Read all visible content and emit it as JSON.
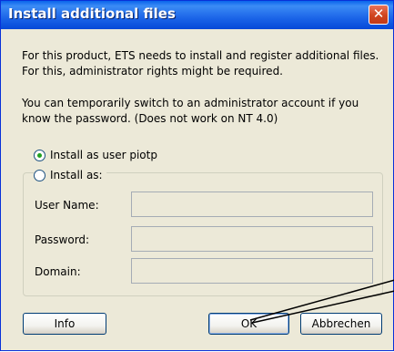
{
  "window": {
    "title": "Install additional files",
    "close_symbol": "✕"
  },
  "message": {
    "line1": "For this product, ETS needs to install and register additional files.",
    "line2": "For this, administrator rights might be required.",
    "line3": "You can temporarily switch to an administrator account if you",
    "line4": "know the password. (Does not work on NT 4.0)"
  },
  "options": {
    "install_as_user": "Install as user piotp",
    "install_as": "Install as:"
  },
  "form": {
    "username_label": "User Name:",
    "password_label": "Password:",
    "domain_label": "Domain:",
    "username_value": "",
    "password_value": "",
    "domain_value": ""
  },
  "buttons": {
    "info": "Info",
    "ok": "OK",
    "cancel": "Abbrechen"
  },
  "icons": {
    "close": "close-icon",
    "radio_checked": "radio-checked-icon",
    "radio_unchecked": "radio-unchecked-icon"
  },
  "colors": {
    "title_bar": "#0a64ec",
    "close_button": "#d0451f",
    "dialog_background": "#ece9d8",
    "radio_dot": "#21a121"
  }
}
